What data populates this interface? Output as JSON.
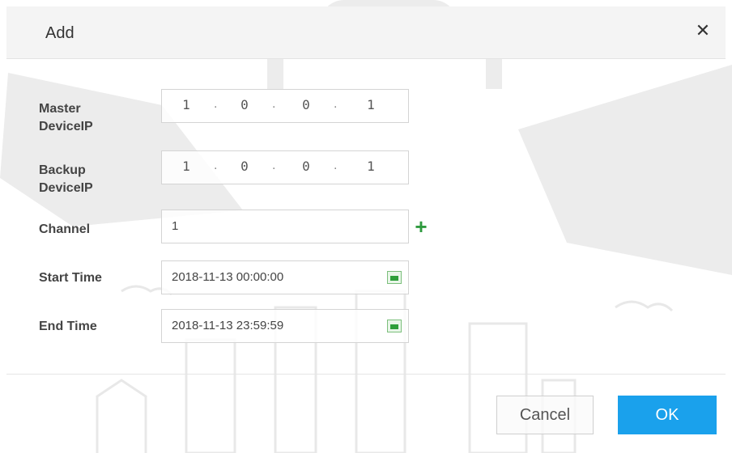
{
  "dialog": {
    "title": "Add",
    "close_icon": "close-icon",
    "master_ip": {
      "label_line1": "Master",
      "label_line2": "DeviceIP",
      "octets": [
        "1",
        "0",
        "0",
        "1"
      ]
    },
    "backup_ip": {
      "label_line1": "Backup",
      "label_line2": "DeviceIP",
      "octets": [
        "1",
        "0",
        "0",
        "1"
      ]
    },
    "channel": {
      "label": "Channel",
      "value": "1",
      "add_icon": "plus-icon"
    },
    "start_time": {
      "label": "Start Time",
      "value": "2018-11-13 00:00:00",
      "icon": "calendar-icon"
    },
    "end_time": {
      "label": "End Time",
      "value": "2018-11-13 23:59:59",
      "icon": "calendar-icon"
    },
    "buttons": {
      "cancel": "Cancel",
      "ok": "OK"
    },
    "colors": {
      "accent": "#1aa1ec",
      "add_green": "#2f9a3f",
      "title_bg": "#f4f4f4"
    }
  }
}
